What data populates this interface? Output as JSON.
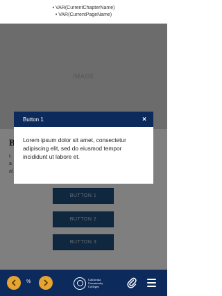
{
  "header": {
    "items": [
      "VAR(CurrentChapterName)",
      "VAR(CurrentPageName)"
    ]
  },
  "image": {
    "label": "IMAGE"
  },
  "content": {
    "heading_fragment": "B",
    "body_fragments": [
      "L",
      "a",
      "al"
    ],
    "buttons": [
      "BUTTON 1",
      "BUTTON 2",
      "BUTTON 3"
    ]
  },
  "modal": {
    "title": "Button 1",
    "close_icon": "×",
    "body": "Lorem ipsum dolor sit amet, consectetur adipiscing elit, sed do eiusmod tempor incididunt ut labore et."
  },
  "footer": {
    "percent": "%",
    "logo_lines": [
      "California",
      "Community",
      "Colleges"
    ],
    "icons": {
      "prev": "chevron-left-icon",
      "next": "chevron-right-icon",
      "attachment": "paperclip-icon",
      "menu": "hamburger-menu-icon"
    },
    "colors": {
      "nav_bar": "#0c2a5b",
      "nav_buttons": "#e6a532",
      "button_fill": "#1e4f7f"
    }
  }
}
